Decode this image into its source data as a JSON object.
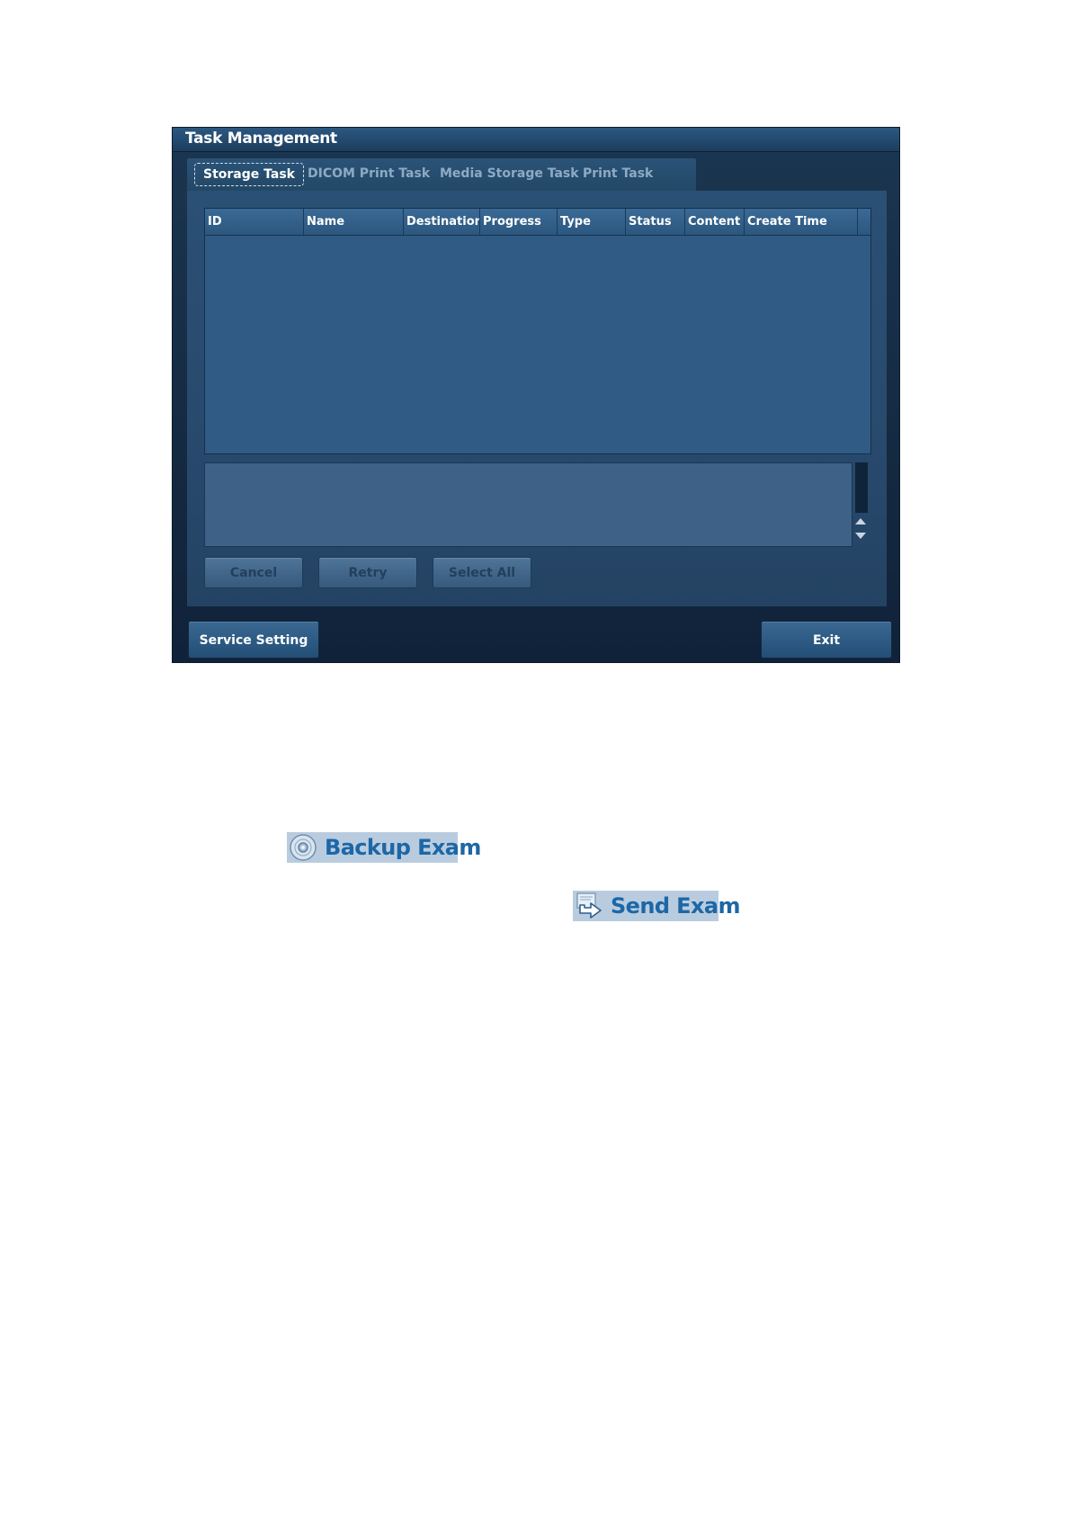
{
  "dialog": {
    "title": "Task Management",
    "tabs": [
      {
        "label": "Storage Task",
        "active": true
      },
      {
        "label": "DICOM Print Task",
        "active": false
      },
      {
        "label": "Media Storage Task",
        "active": false
      },
      {
        "label": "Print Task",
        "active": false
      }
    ],
    "table": {
      "columns": [
        "ID",
        "Name",
        "Destination",
        "Progress",
        "Type",
        "Status",
        "Content",
        "Create Time"
      ],
      "rows": []
    },
    "actions": {
      "cancel_label": "Cancel",
      "retry_label": "Retry",
      "select_all_label": "Select All"
    },
    "footer": {
      "service_setting_label": "Service Setting",
      "exit_label": "Exit"
    }
  },
  "extra_buttons": {
    "backup_exam_label": "Backup Exam",
    "backup_exam_icon": "disc-icon",
    "send_exam_label": "Send Exam",
    "send_exam_icon": "send-arrow-icon"
  },
  "colors": {
    "dialog_bg": "#13283f",
    "titlebar": "#234a6e",
    "panel": "#27486b",
    "exam_label": "#1d67a6",
    "exam_bg": "#b9ccdf"
  }
}
